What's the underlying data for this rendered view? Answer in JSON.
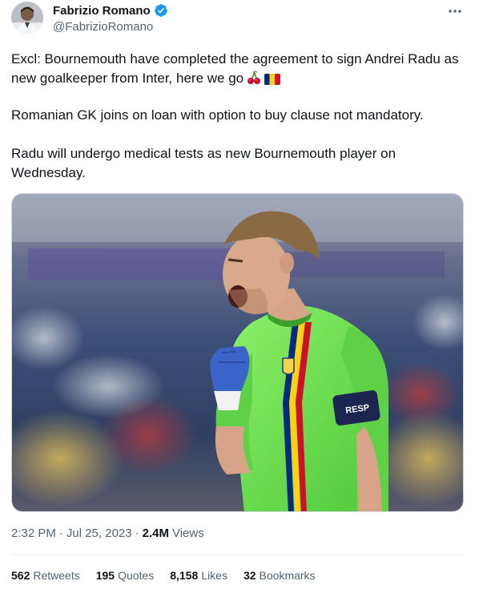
{
  "author": {
    "display_name": "Fabrizio Romano",
    "handle": "@FabrizioRomano",
    "verified": true,
    "avatar_icon": "profile-photo"
  },
  "tweet": {
    "paragraph1": "Excl: Bournemouth have completed the agreement to sign Andrei Radu as new goalkeeper from Inter, here we go",
    "paragraph1_emojis": [
      "cherries-emoji",
      "romania-flag-emoji"
    ],
    "paragraph2": "Romanian GK joins on loan with option to buy clause not mandatory.",
    "paragraph3": "Radu will undergo medical tests as new Bournemouth player on Wednesday."
  },
  "media": {
    "image_icon": "goalkeeper-celebration-photo",
    "armband_text": "RESP"
  },
  "meta": {
    "time": "2:32 PM",
    "separator1": "·",
    "date": "Jul 25, 2023",
    "separator2": "·",
    "views_count": "2.4M",
    "views_label": "Views"
  },
  "stats": {
    "retweets_count": "562",
    "retweets_label": "Retweets",
    "quotes_count": "195",
    "quotes_label": "Quotes",
    "likes_count": "8,158",
    "likes_label": "Likes",
    "bookmarks_count": "32",
    "bookmarks_label": "Bookmarks"
  },
  "colors": {
    "verified_blue": "#1d9bf0",
    "secondary_text": "#536471",
    "primary_text": "#0f1419"
  }
}
